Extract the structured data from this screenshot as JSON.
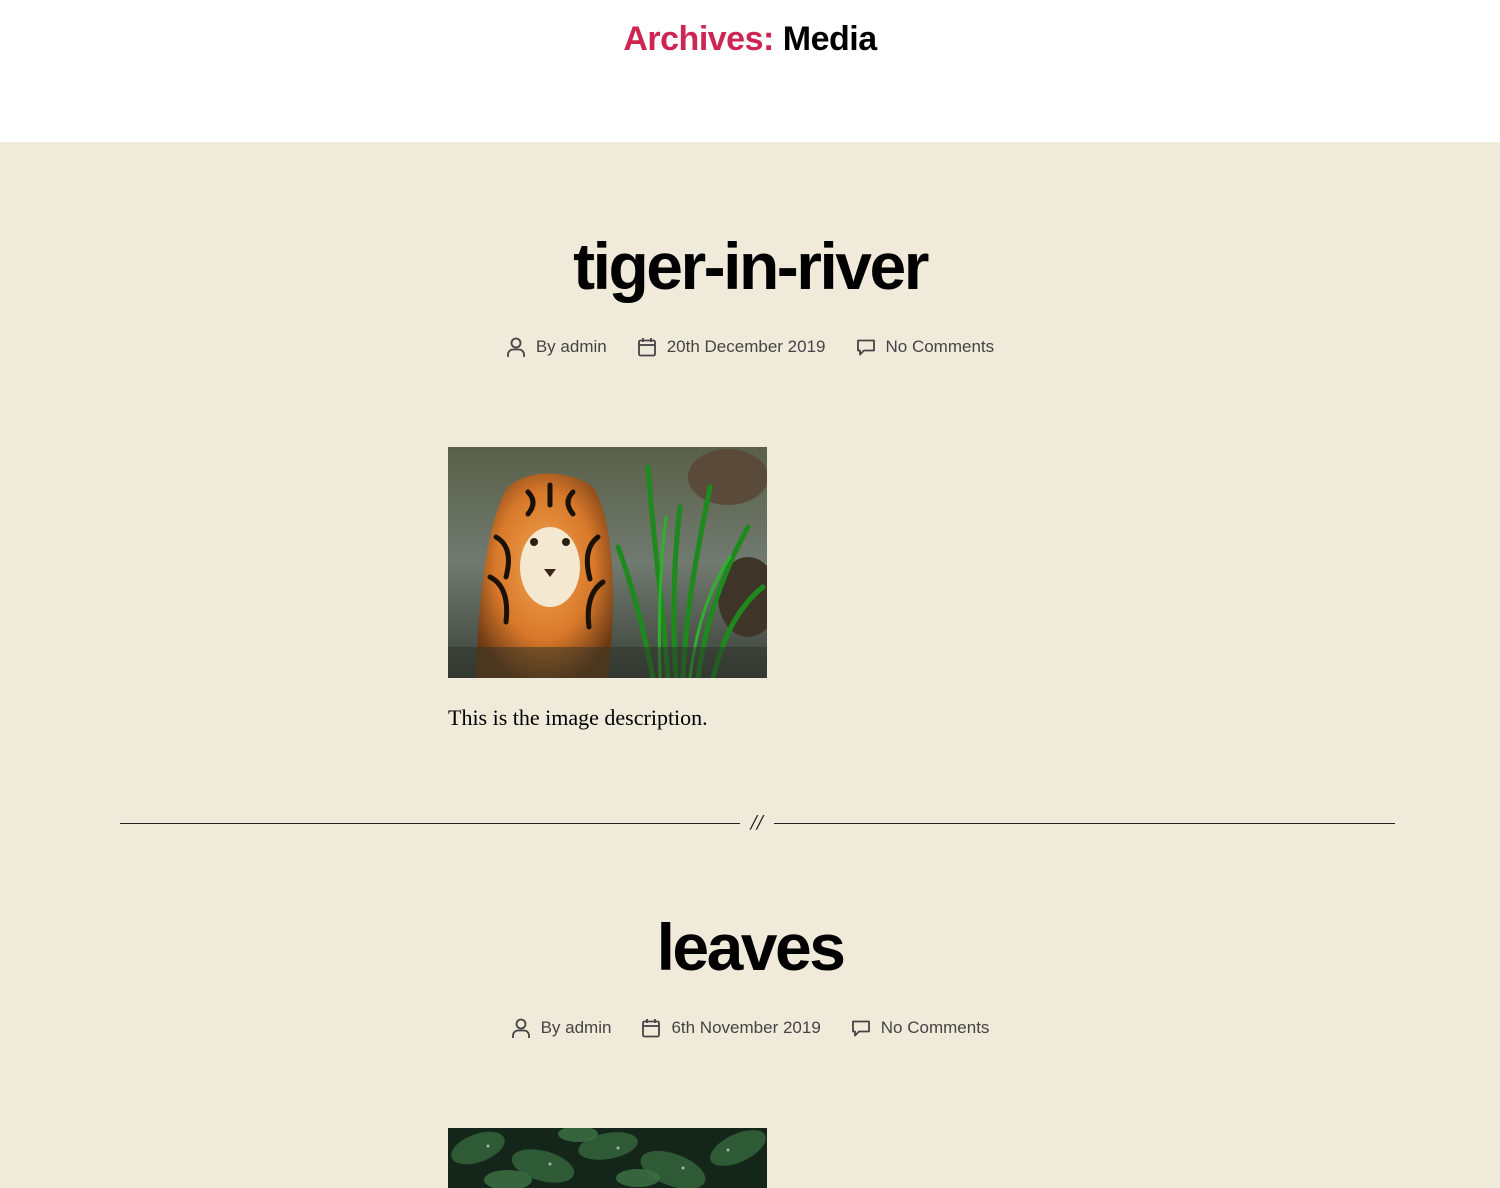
{
  "archive": {
    "prefix": "Archives:",
    "name": "Media"
  },
  "posts": [
    {
      "title": "tiger-in-river",
      "author": "By admin",
      "date": "20th December 2019",
      "comments": "No Comments",
      "description": "This is the image description."
    },
    {
      "title": "leaves",
      "author": "By admin",
      "date": "6th November 2019",
      "comments": "No Comments"
    }
  ],
  "separator": "//",
  "colors": {
    "accent": "#cd2653",
    "background": "#f0eada",
    "header_background": "#ffffff",
    "meta_text": "#444444"
  },
  "icons": [
    "user-icon",
    "calendar-icon",
    "comment-icon"
  ]
}
